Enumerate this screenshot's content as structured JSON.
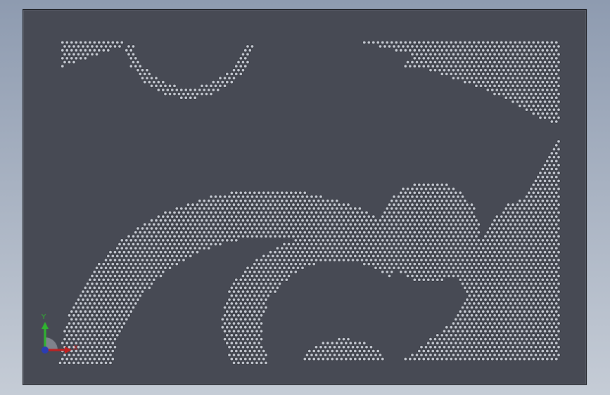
{
  "viewport": {
    "background_top": "#8e9bb0",
    "background_bottom": "#c5ccd6",
    "plate_color": "#474a54",
    "hole_fill": "#c9cdd6",
    "hole_stroke": "#2b2e35"
  },
  "triad": {
    "y_label": "Y",
    "x_label": "X",
    "y_color": "#2fb52f",
    "x_color": "#c02020",
    "z_color": "#2b3db3"
  }
}
